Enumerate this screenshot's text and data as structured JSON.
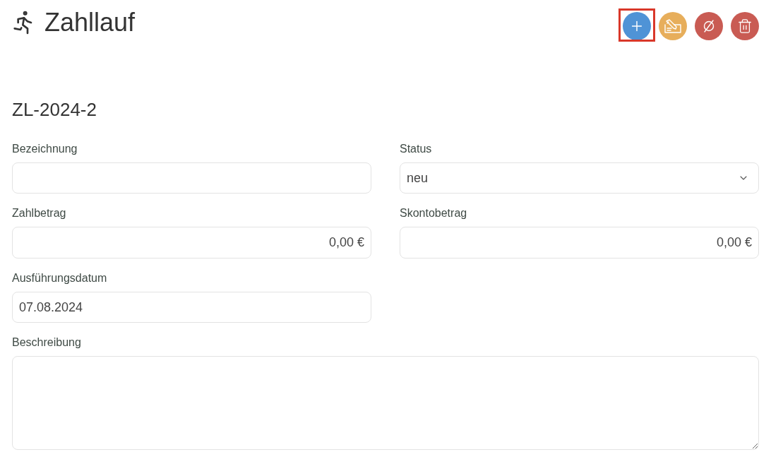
{
  "header": {
    "title": "Zahllauf",
    "actions": [
      {
        "kind": "add",
        "highlighted": true
      },
      {
        "kind": "sign",
        "highlighted": false
      },
      {
        "kind": "cancel",
        "highlighted": false
      },
      {
        "kind": "delete",
        "highlighted": false
      }
    ]
  },
  "record": {
    "number": "ZL-2024-2",
    "fields": [
      {
        "label": "Bezeichnung",
        "kind": "text"
      },
      {
        "label": "Status",
        "kind": "select",
        "value": "neu"
      },
      {
        "label": "Zahlbetrag",
        "kind": "amount",
        "value": "0,00 €"
      },
      {
        "label": "Skontobetrag",
        "kind": "amount",
        "value": "0,00 €"
      },
      {
        "label": "Ausführungsdatum",
        "kind": "date",
        "value": "07.08.2024"
      },
      {
        "label": "Beschreibung",
        "kind": "textarea"
      }
    ]
  }
}
